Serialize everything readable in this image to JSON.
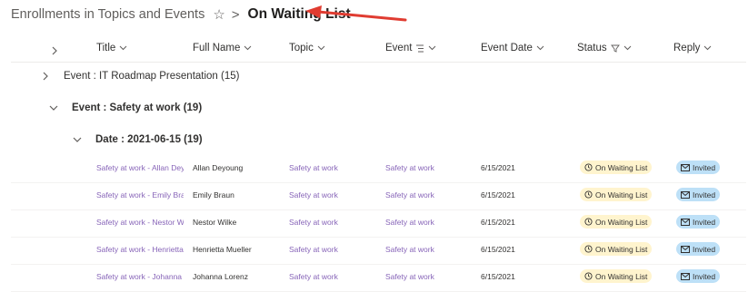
{
  "breadcrumb": {
    "parent": "Enrollments in Topics and Events",
    "current": "On Waiting List"
  },
  "columns": [
    "Title",
    "Full Name",
    "Topic",
    "Event",
    "Event Date",
    "Status",
    "Reply"
  ],
  "groups": {
    "event1": "Event : IT Roadmap Presentation (15)",
    "event2": "Event : Safety at work (19)",
    "date1": "Date : 2021-06-15 (19)"
  },
  "rows": [
    {
      "title": "Safety at work - Allan Deyoung",
      "name": "Allan Deyoung",
      "topic": "Safety at work",
      "event": "Safety at work",
      "date": "6/15/2021",
      "status": "On Waiting List",
      "reply": "Invited"
    },
    {
      "title": "Safety at work - Emily Braun",
      "name": "Emily Braun",
      "topic": "Safety at work",
      "event": "Safety at work",
      "date": "6/15/2021",
      "status": "On Waiting List",
      "reply": "Invited"
    },
    {
      "title": "Safety at work - Nestor Wilke",
      "name": "Nestor Wilke",
      "topic": "Safety at work",
      "event": "Safety at work",
      "date": "6/15/2021",
      "status": "On Waiting List",
      "reply": "Invited"
    },
    {
      "title": "Safety at work - Henrietta Mueller",
      "name": "Henrietta Mueller",
      "topic": "Safety at work",
      "event": "Safety at work",
      "date": "6/15/2021",
      "status": "On Waiting List",
      "reply": "Invited"
    },
    {
      "title": "Safety at work - Johanna Lorenz",
      "name": "Johanna Lorenz",
      "topic": "Safety at work",
      "event": "Safety at work",
      "date": "6/15/2021",
      "status": "On Waiting List",
      "reply": "Invited"
    }
  ],
  "colors": {
    "link": "#8764b8",
    "status_bg": "#fff4ce",
    "reply_bg": "#bde0f7",
    "annotation_arrow": "#e03c31"
  }
}
